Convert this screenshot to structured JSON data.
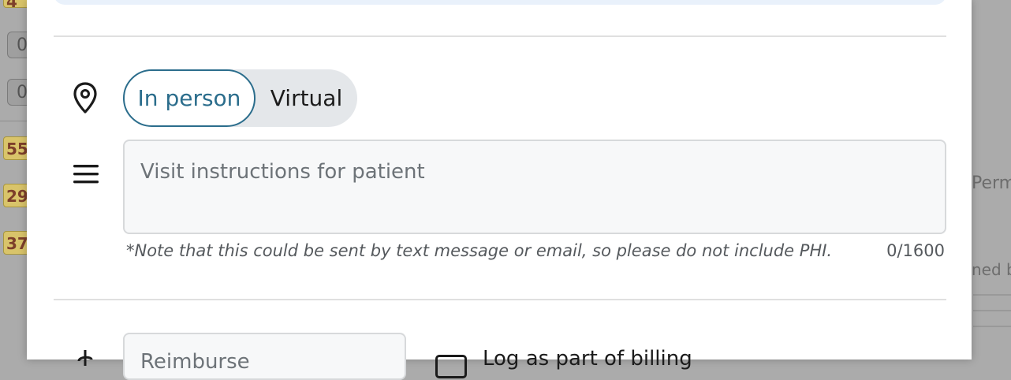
{
  "background": {
    "left_badges": [
      "4",
      "55",
      "29",
      "37"
    ],
    "left_chips": [
      "0",
      "0"
    ],
    "right_texts": [
      "Perm",
      "ned b"
    ]
  },
  "modal": {
    "location": {
      "icon": "map-pin-icon",
      "options": [
        "In person",
        "Virtual"
      ],
      "selected": "In person"
    },
    "instructions": {
      "icon": "menu-lines-icon",
      "placeholder": "Visit instructions for patient",
      "value": "",
      "note": "*Note that this could be sent by text message or email, so please do not include PHI.",
      "counter": "0/1600"
    },
    "bottom_row": {
      "icon": "dollar-icon",
      "field_placeholder": "Reimburse",
      "checkbox_label": "Log as part of billing"
    }
  },
  "colors": {
    "accent": "#2b6d8c",
    "toggle_bg": "#e4e7ea",
    "banner_bg": "#e9f1fb"
  }
}
